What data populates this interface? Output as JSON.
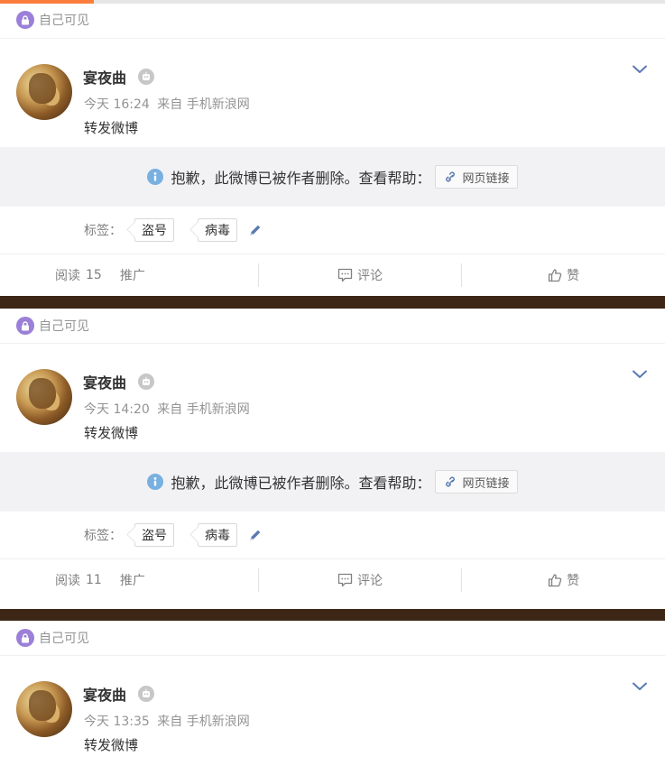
{
  "posts": [
    {
      "visibility": "自己可见",
      "author": "宴夜曲",
      "time": "今天 16:24",
      "source_prefix": "来自",
      "source": "手机新浪网",
      "text": "转发微博",
      "deleted_notice": "抱歉，此微博已被作者删除。查看帮助：",
      "link_label": "网页链接",
      "tags_label": "标签：",
      "tags": [
        "盗号",
        "病毒"
      ],
      "read_label": "阅读",
      "read_count": "15",
      "promote_label": "推广",
      "comment_label": "评论",
      "like_label": "赞"
    },
    {
      "visibility": "自己可见",
      "author": "宴夜曲",
      "time": "今天 14:20",
      "source_prefix": "来自",
      "source": "手机新浪网",
      "text": "转发微博",
      "deleted_notice": "抱歉，此微博已被作者删除。查看帮助：",
      "link_label": "网页链接",
      "tags_label": "标签：",
      "tags": [
        "盗号",
        "病毒"
      ],
      "read_label": "阅读",
      "read_count": "11",
      "promote_label": "推广",
      "comment_label": "评论",
      "like_label": "赞"
    },
    {
      "visibility": "自己可见",
      "author": "宴夜曲",
      "time": "今天 13:35",
      "source_prefix": "来自",
      "source": "手机新浪网",
      "text": "转发微博"
    }
  ],
  "icons": {
    "visibility": "lock-icon",
    "author_badge": "robot-icon",
    "menu": "chevron-down-icon",
    "notice": "info-icon",
    "link": "link-icon",
    "edit_tags": "pencil-icon",
    "comment": "comment-icon",
    "like": "thumbs-up-icon"
  },
  "colors": {
    "accent": "#fa7d3c",
    "lock": "#9b7fd8",
    "link_blue": "#5a7ab0",
    "info": "#78b0e0",
    "feed_background": "#3d2616"
  }
}
